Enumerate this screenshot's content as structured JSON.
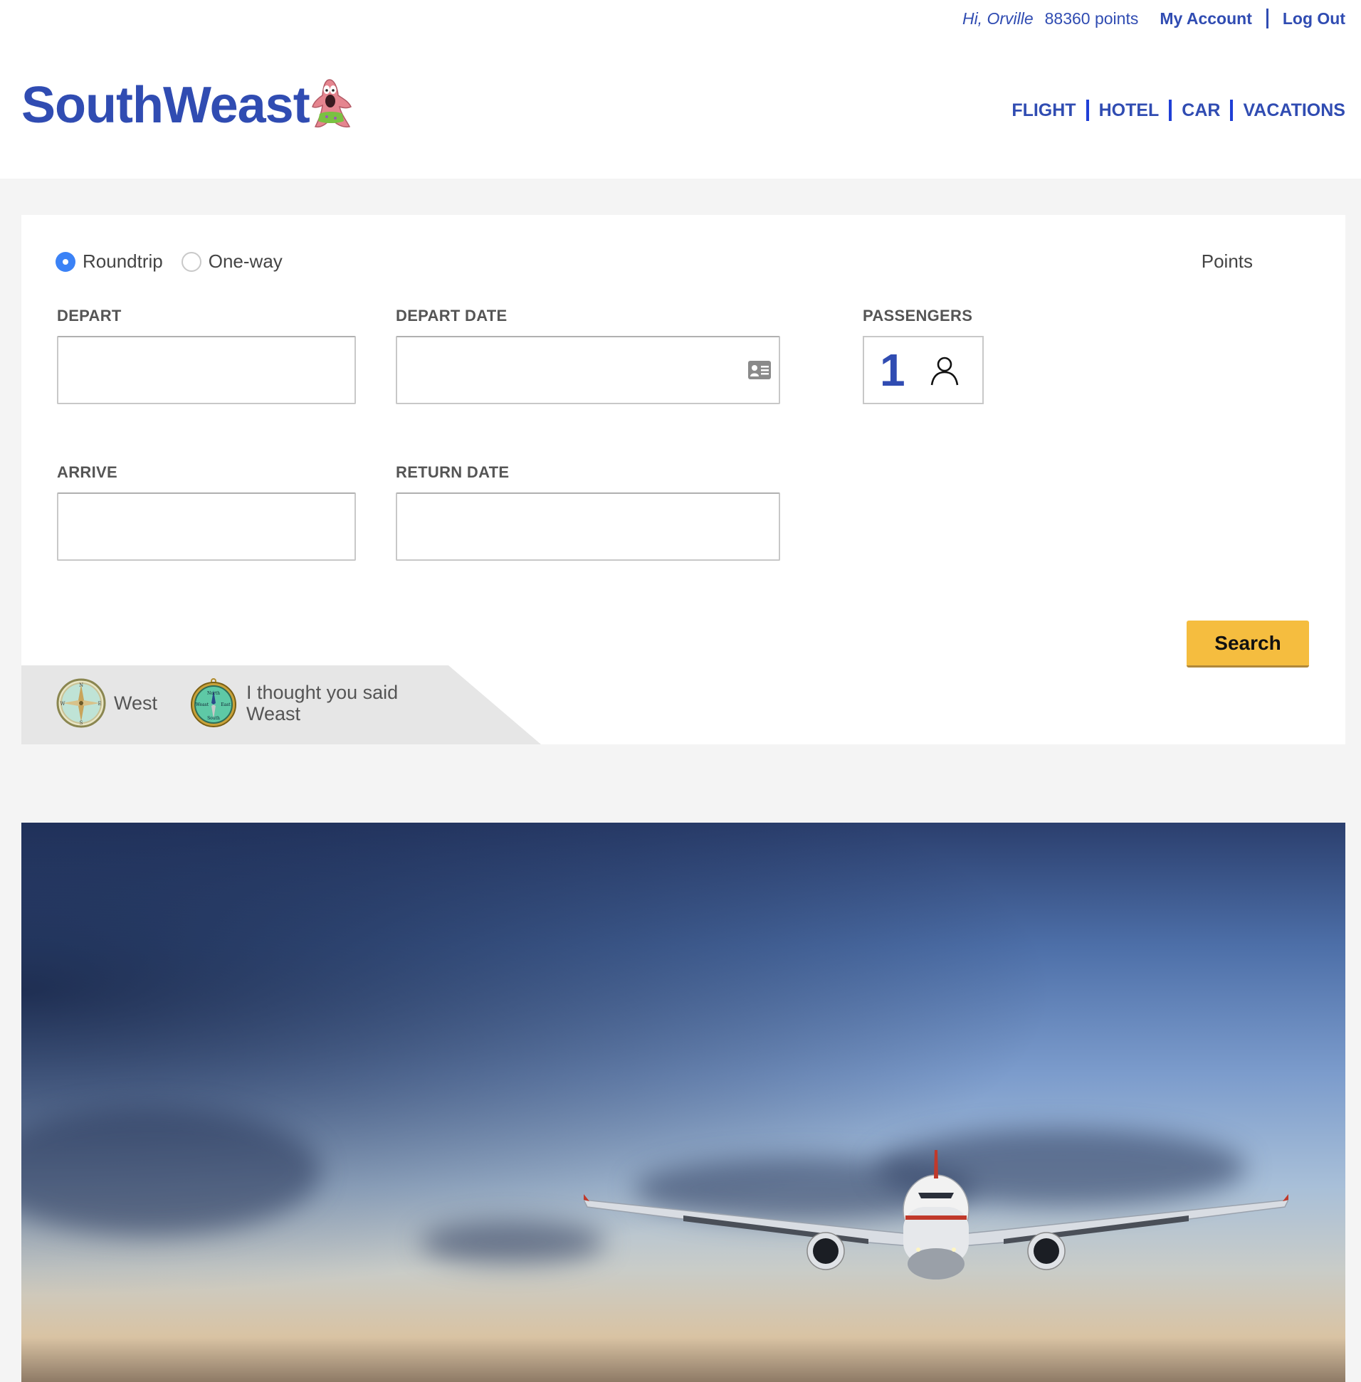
{
  "header": {
    "greeting": "Hi, Orville",
    "points": "88360 points",
    "my_account": "My Account",
    "log_out": "Log Out",
    "logo_text": "SouthWeast",
    "nav": [
      "FLIGHT",
      "HOTEL",
      "CAR",
      "VACATIONS"
    ]
  },
  "booking": {
    "trip_types": [
      {
        "label": "Roundtrip",
        "selected": true
      },
      {
        "label": "One-way",
        "selected": false
      }
    ],
    "points_label": "Points",
    "depart": {
      "label": "DEPART",
      "value": ""
    },
    "depart_date": {
      "label": "DEPART DATE",
      "value": ""
    },
    "arrive": {
      "label": "ARRIVE",
      "value": ""
    },
    "return_date": {
      "label": "RETURN DATE",
      "value": ""
    },
    "passengers": {
      "label": "PASSENGERS",
      "count": "1"
    },
    "search_label": "Search"
  },
  "promo": {
    "items": [
      {
        "icon": "compass-icon",
        "text": "West"
      },
      {
        "icon": "weast-compass-icon",
        "text_line1": "I thought you said",
        "text_line2": "Weast"
      }
    ]
  },
  "colors": {
    "brand_blue": "#304cb2",
    "search_yellow": "#f5bd3f",
    "radio_blue": "#3b82f6"
  }
}
